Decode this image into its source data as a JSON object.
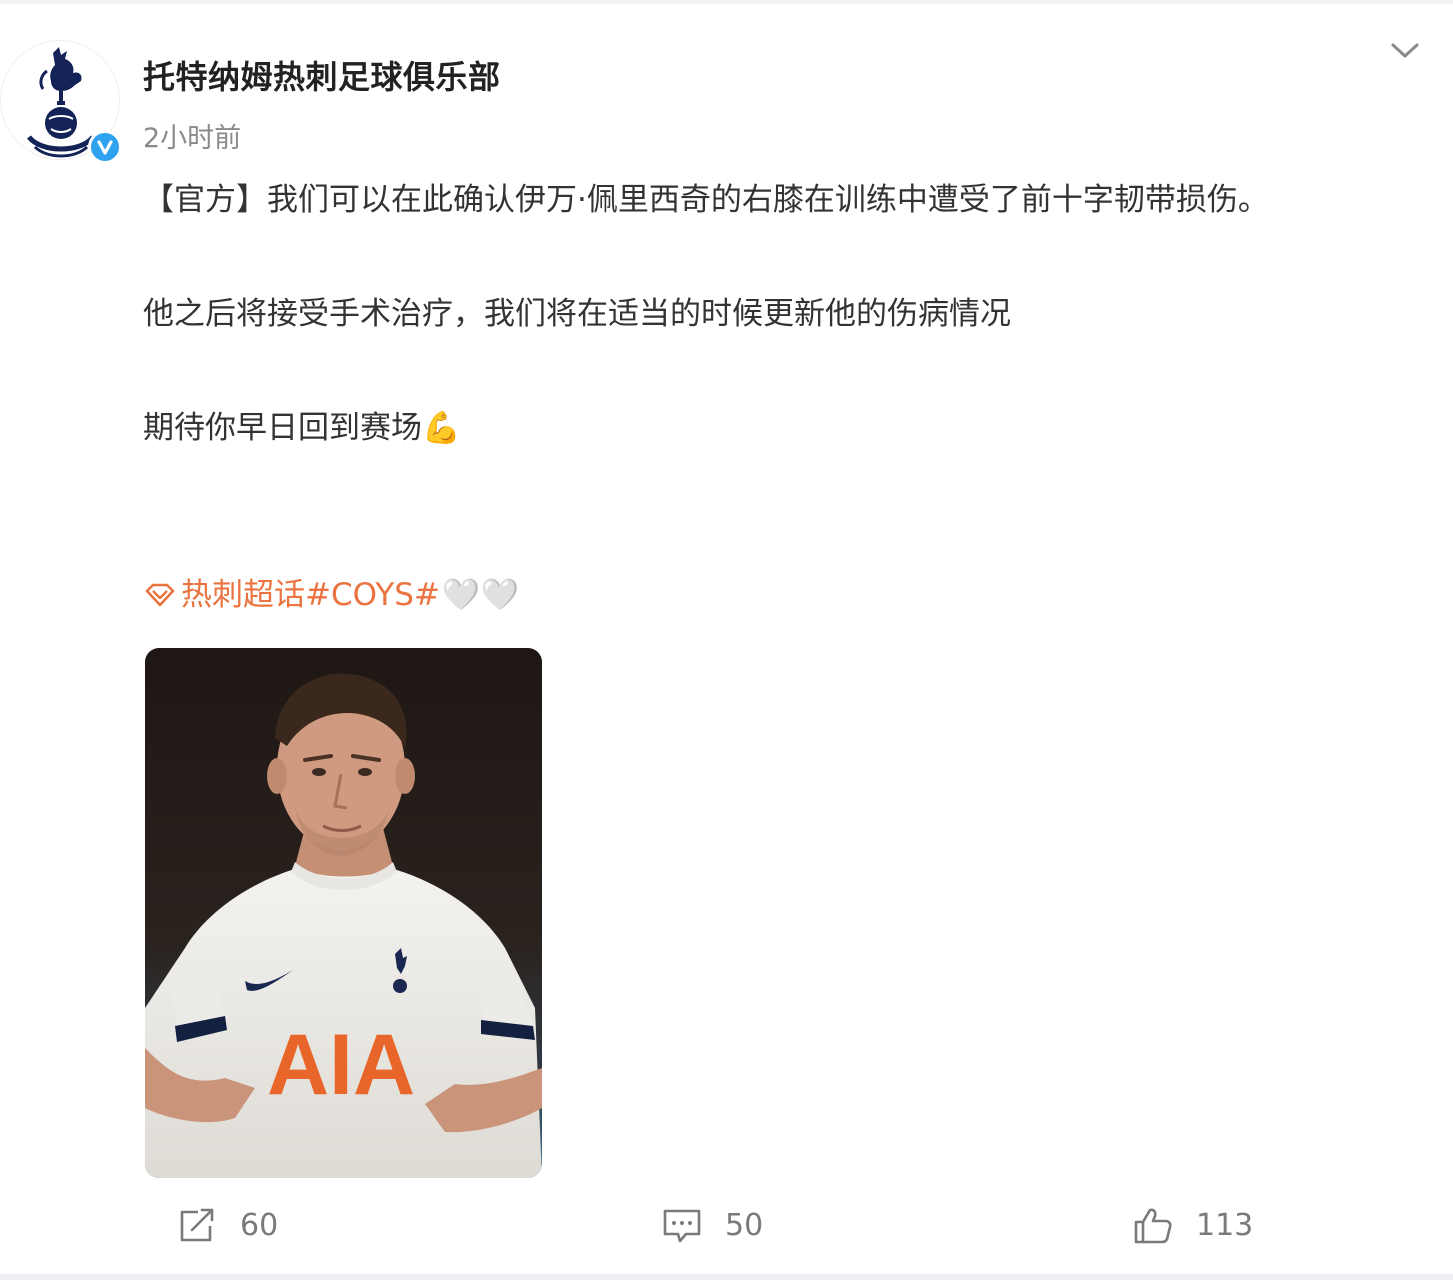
{
  "post": {
    "author": "托特纳姆热刺足球俱乐部",
    "time": "2小时前",
    "paragraphs": [
      "【官方】我们可以在此确认伊万·佩里西奇的右膝在训练中遭受了前十字韧带损伤。",
      "他之后将接受手术治疗，我们将在适当的时候更新他的伤病情况",
      "期待你早日回到赛场💪"
    ],
    "topic": "热刺超话#COYS#",
    "hearts": "🤍🤍",
    "image_alt": "AIA"
  },
  "stats": {
    "reposts": "60",
    "comments": "50",
    "likes": "113"
  },
  "colors": {
    "topic": "#eb7340",
    "verified": "#2ea1ef",
    "spurs_navy": "#132257",
    "text": "#333333",
    "muted": "#8a8a8a"
  },
  "icons": {
    "avatar": "spurs-crest-icon",
    "verified": "verified-badge-icon",
    "more": "chevron-down-icon",
    "topic": "super-topic-icon",
    "repost": "repost-icon",
    "comment": "comment-icon",
    "like": "thumbs-up-icon"
  }
}
